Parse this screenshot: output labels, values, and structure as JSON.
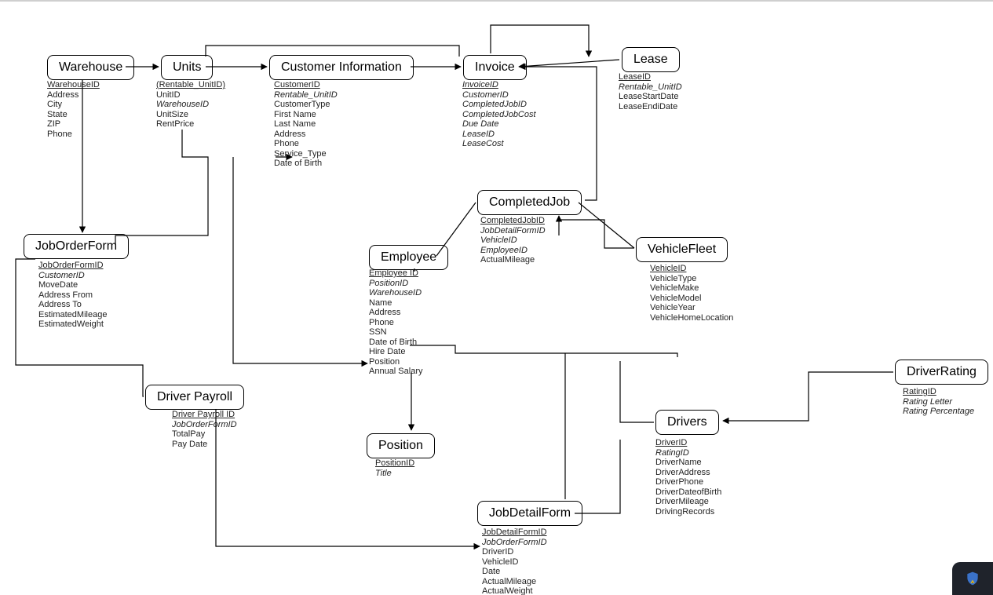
{
  "entities": {
    "warehouse": {
      "title": "Warehouse",
      "attrs": [
        {
          "t": "WarehouseID",
          "pk": true
        },
        {
          "t": "Address"
        },
        {
          "t": "City"
        },
        {
          "t": "State"
        },
        {
          "t": "ZIP"
        },
        {
          "t": "Phone"
        }
      ]
    },
    "units": {
      "title": "Units",
      "attrs": [
        {
          "t": "(Rentable_UnitID)",
          "pk": true
        },
        {
          "t": "UnitID"
        },
        {
          "t": "WarehouseID",
          "fk": true
        },
        {
          "t": "UnitSize"
        },
        {
          "t": "RentPrice"
        }
      ]
    },
    "custinfo": {
      "title": "Customer Information",
      "attrs": [
        {
          "t": "CustomerID",
          "pk": true
        },
        {
          "t": "Rentable_UnitID",
          "fk": true
        },
        {
          "t": "CustomerType"
        },
        {
          "t": "First Name"
        },
        {
          "t": "Last Name"
        },
        {
          "t": "Address"
        },
        {
          "t": "Phone"
        },
        {
          "t": "Service_Type"
        },
        {
          "t": "Date of Birth"
        }
      ]
    },
    "invoice": {
      "title": "Invoice",
      "attrs": [
        {
          "t": "InvoiceID",
          "pk": true,
          "fk": true
        },
        {
          "t": "CustomerID",
          "fk": true
        },
        {
          "t": "CompletedJobID",
          "fk": true
        },
        {
          "t": "CompletedJobCost",
          "fk": true
        },
        {
          "t": "Due Date",
          "fk": true
        },
        {
          "t": "LeaseID",
          "fk": true
        },
        {
          "t": "LeaseCost",
          "fk": true
        }
      ]
    },
    "lease": {
      "title": "Lease",
      "attrs": [
        {
          "t": "LeaseID",
          "pk": true
        },
        {
          "t": "Rentable_UnitID",
          "fk": true
        },
        {
          "t": "LeaseStartDate"
        },
        {
          "t": "LeaseEndiDate"
        }
      ]
    },
    "joborder": {
      "title": "JobOrderForm",
      "attrs": [
        {
          "t": "JobOrderFormID",
          "pk": true
        },
        {
          "t": "CustomerID",
          "fk": true
        },
        {
          "t": "MoveDate"
        },
        {
          "t": "Address From"
        },
        {
          "t": "Address To"
        },
        {
          "t": "EstimatedMileage"
        },
        {
          "t": "EstimatedWeight"
        }
      ]
    },
    "employee": {
      "title": "Employee",
      "attrs": [
        {
          "t": "Employee ID",
          "pk": true
        },
        {
          "t": "PositionID",
          "fk": true
        },
        {
          "t": "WarehouseID",
          "fk": true
        },
        {
          "t": "Name"
        },
        {
          "t": "Address"
        },
        {
          "t": "Phone"
        },
        {
          "t": "SSN"
        },
        {
          "t": "Date of Birth"
        },
        {
          "t": "Hire Date"
        },
        {
          "t": "Position"
        },
        {
          "t": "Annual Salary"
        }
      ]
    },
    "completedjob": {
      "title": "CompletedJob",
      "attrs": [
        {
          "t": "CompletedJobID",
          "pk": true
        },
        {
          "t": "JobDetailFormID",
          "fk": true
        },
        {
          "t": "VehicleID",
          "fk": true
        },
        {
          "t": "EmployeeID",
          "fk": true
        },
        {
          "t": "ActualMileage"
        }
      ]
    },
    "vehiclefleet": {
      "title": "VehicleFleet",
      "attrs": [
        {
          "t": "VehicleID",
          "pk": true
        },
        {
          "t": "VehicleType"
        },
        {
          "t": "VehicleMake"
        },
        {
          "t": "VehicleModel"
        },
        {
          "t": "VehicleYear"
        },
        {
          "t": "VehicleHomeLocation"
        }
      ]
    },
    "driverpayroll": {
      "title": "Driver Payroll",
      "attrs": [
        {
          "t": "Driver Payroll ID",
          "pk": true
        },
        {
          "t": "JobOrderFormID",
          "fk": true
        },
        {
          "t": "TotalPay"
        },
        {
          "t": "Pay Date"
        }
      ]
    },
    "position": {
      "title": "Position",
      "attrs": [
        {
          "t": "PositionID",
          "pk": true
        },
        {
          "t": "Title",
          "fk": true
        }
      ]
    },
    "drivers": {
      "title": "Drivers",
      "attrs": [
        {
          "t": "DriverID",
          "pk": true
        },
        {
          "t": "RatingID",
          "fk": true
        },
        {
          "t": "DriverName"
        },
        {
          "t": "DriverAddress"
        },
        {
          "t": "DriverPhone"
        },
        {
          "t": "DriverDateofBirth"
        },
        {
          "t": "DriverMileage"
        },
        {
          "t": "DrivingRecords"
        }
      ]
    },
    "driverrating": {
      "title": "DriverRating",
      "attrs": [
        {
          "t": "RatingID",
          "pk": true
        },
        {
          "t": "Rating Letter",
          "fk": true
        },
        {
          "t": "Rating Percentage",
          "fk": true
        }
      ]
    },
    "jobdetailform": {
      "title": "JobDetailForm",
      "attrs": [
        {
          "t": "JobDetailFormID",
          "pk": true
        },
        {
          "t": "JobOrderFormID",
          "fk": true
        },
        {
          "t": "DriverID"
        },
        {
          "t": "VehicleID"
        },
        {
          "t": "Date"
        },
        {
          "t": "ActualMileage"
        },
        {
          "t": "ActualWeight"
        }
      ]
    }
  }
}
